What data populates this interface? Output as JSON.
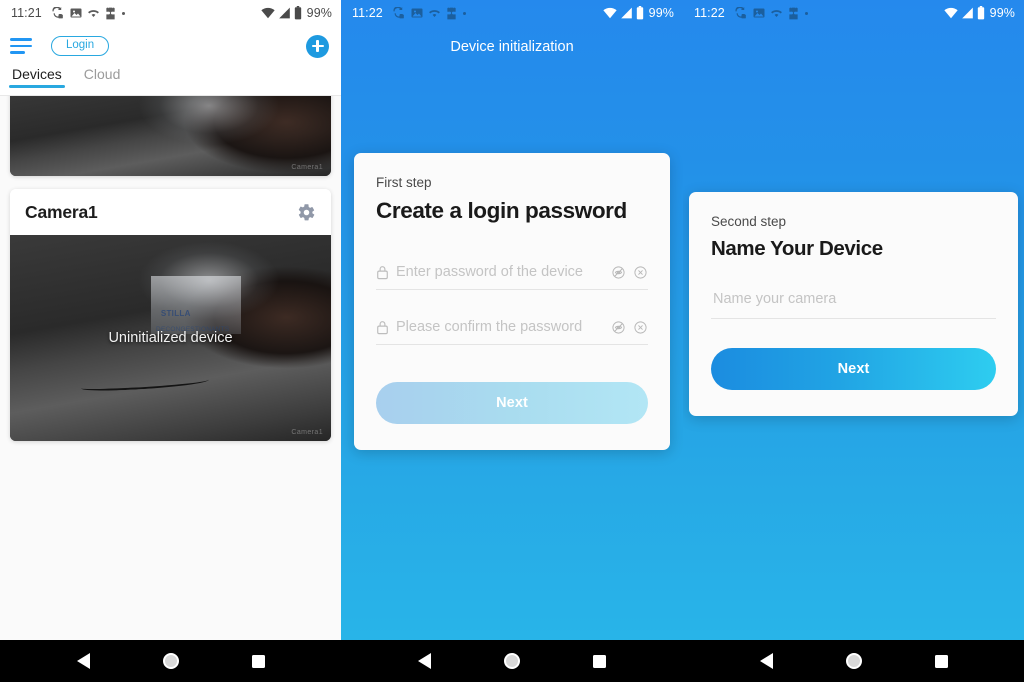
{
  "screens": [
    {
      "id": "device-list",
      "status_bar": {
        "time": "11:21",
        "battery_percent": "99%",
        "icons_left": [
          "sync-icon",
          "image-icon",
          "wifi-alt-icon",
          "puzzle-icon",
          "dot-icon"
        ],
        "icons_right": [
          "wifi-icon",
          "cellular-signal-icon",
          "battery-icon"
        ]
      },
      "appbar": {
        "menu_icon": "hamburger-menu-icon",
        "login_label": "Login",
        "add_icon": "add-plus-icon"
      },
      "tabs": [
        {
          "label": "Devices",
          "active": true
        },
        {
          "label": "Cloud",
          "active": false
        }
      ],
      "devices": [
        {
          "title": "",
          "overlay_text": "",
          "watermark": "Camera1",
          "partial": true
        },
        {
          "title": "Camera1",
          "overlay_text": "Uninitialized device",
          "watermark": "Camera1",
          "settings_icon": "gear-icon"
        }
      ]
    },
    {
      "id": "create-password",
      "status_bar": {
        "time": "11:22",
        "battery_percent": "99%"
      },
      "title": "Device initialization",
      "dialog": {
        "step": "First step",
        "heading": "Create a login password",
        "fields": [
          {
            "name": "password",
            "placeholder": "Enter password of the device",
            "value": "",
            "lead_icon": "lock-icon",
            "trail_icons": [
              "eye-off-icon",
              "clear-circle-icon"
            ]
          },
          {
            "name": "confirm-password",
            "placeholder": "Please confirm the password",
            "value": "",
            "lead_icon": "lock-icon",
            "trail_icons": [
              "eye-off-icon",
              "clear-circle-icon"
            ]
          }
        ],
        "next_label": "Next",
        "next_enabled": false
      }
    },
    {
      "id": "name-device",
      "status_bar": {
        "time": "11:22",
        "battery_percent": "99%"
      },
      "title": "",
      "dialog": {
        "step": "Second step",
        "heading": "Name Your Device",
        "fields": [
          {
            "name": "device-name",
            "placeholder": "Name your camera",
            "value": ""
          }
        ],
        "next_label": "Next",
        "next_enabled": true
      }
    }
  ],
  "nav_bar": {
    "back_icon": "back-triangle-icon",
    "home_icon": "home-circle-icon",
    "recents_icon": "recents-square-icon"
  },
  "colors": {
    "accent_blue": "#29a8e0",
    "gradient_top": "#2589ed",
    "gradient_bottom": "#29b7e9",
    "button_left": "#1b8ce0",
    "button_right": "#2ecdf0",
    "nav_background": "#000000"
  }
}
